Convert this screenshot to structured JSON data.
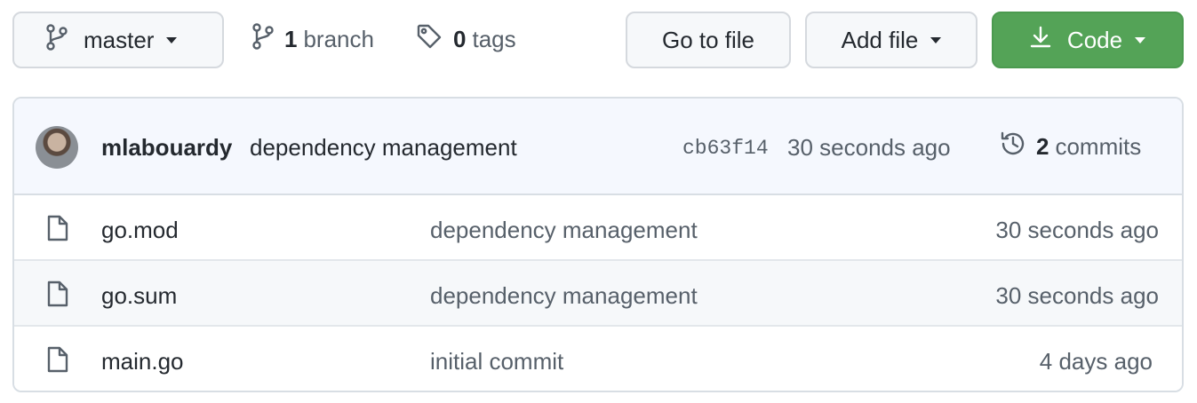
{
  "toolbar": {
    "branch_label": "master",
    "branches_count": "1",
    "branches_label": "branch",
    "tags_count": "0",
    "tags_label": "tags",
    "goto_label": "Go to file",
    "addfile_label": "Add file",
    "code_label": "Code"
  },
  "latest_commit": {
    "author": "mlabouardy",
    "message": "dependency management",
    "sha": "cb63f14",
    "time": "30 seconds ago",
    "commits_count": "2",
    "commits_label": "commits"
  },
  "files": [
    {
      "name": "go.mod",
      "message": "dependency management",
      "age": "30 seconds ago"
    },
    {
      "name": "go.sum",
      "message": "dependency management",
      "age": "30 seconds ago"
    },
    {
      "name": "main.go",
      "message": "initial commit",
      "age": "4 days ago"
    }
  ],
  "colors": {
    "code_button": "#54a357",
    "commit_bar": "#f5f8fe",
    "border": "#d8dee4"
  },
  "icons": [
    "git-branch-icon",
    "tag-icon",
    "download-icon",
    "history-icon",
    "file-icon"
  ]
}
